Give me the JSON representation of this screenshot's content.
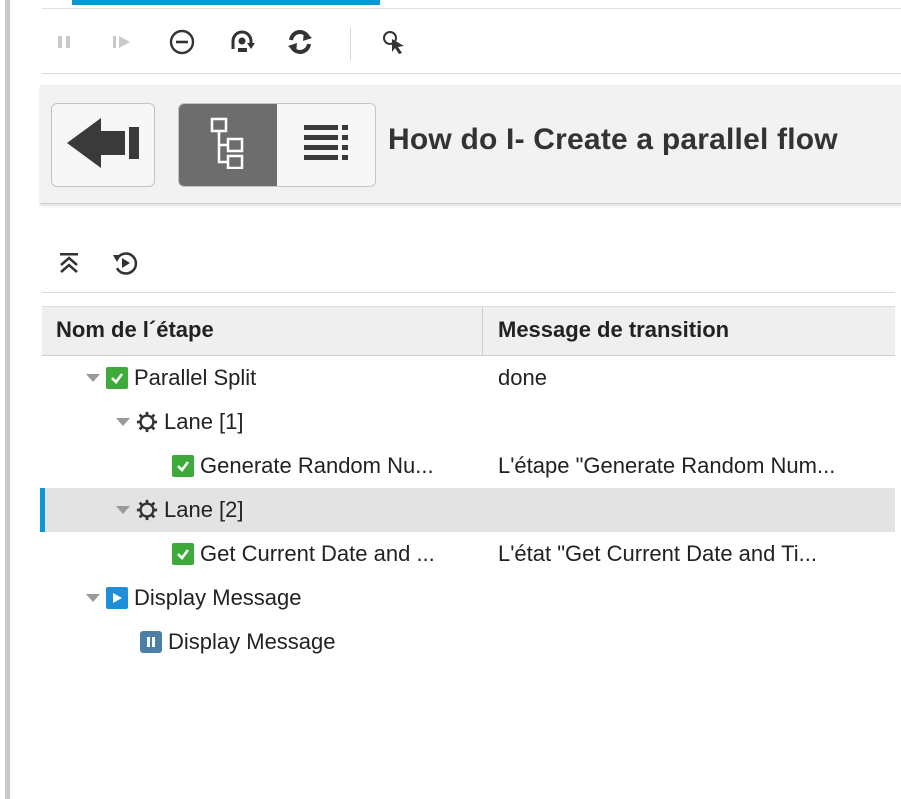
{
  "toolbar": {
    "buttons": [
      {
        "name": "pause-icon",
        "tip": "pause"
      },
      {
        "name": "resume-icon",
        "tip": "resume"
      },
      {
        "name": "cancel-icon",
        "tip": "cancel"
      },
      {
        "name": "reassign-icon",
        "tip": "reassign"
      },
      {
        "name": "refresh-icon",
        "tip": "refresh"
      },
      {
        "name": "cursor-select-icon",
        "tip": "select"
      }
    ]
  },
  "header": {
    "title": "How do I- Create a parallel flow",
    "back_icon": "back-arrow-icon",
    "tree_view_icon": "tree-view-icon",
    "list_view_icon": "list-view-icon"
  },
  "tree_tools": {
    "collapse_icon": "collapse-all-icon",
    "replay_icon": "replay-icon"
  },
  "grid": {
    "columns": [
      "Nom de l´étape",
      "Message de transition"
    ],
    "rows": [
      {
        "name": "Parallel Split",
        "message": "done",
        "status": "success",
        "indent": 0,
        "expandable": true
      },
      {
        "name": "Lane [1]",
        "message": "",
        "status": "lane",
        "indent": 1,
        "expandable": true
      },
      {
        "name": "Generate Random Nu...",
        "message": "L'étape \"Generate Random Num...",
        "status": "success",
        "indent": 2,
        "expandable": false
      },
      {
        "name": "Lane [2]",
        "message": "",
        "status": "lane",
        "indent": 1,
        "expandable": true,
        "selected": true
      },
      {
        "name": "Get Current Date and ...",
        "message": "L'état \"Get Current Date and Ti...",
        "status": "success",
        "indent": 2,
        "expandable": false
      },
      {
        "name": "Display Message",
        "message": "",
        "status": "running",
        "indent": 0,
        "expandable": true
      },
      {
        "name": "Display Message",
        "message": "",
        "status": "paused",
        "indent": 1,
        "expandable": false
      }
    ]
  },
  "colors": {
    "accent": "#0b96d6",
    "success": "#3eaa3c",
    "running": "#1e8fd6",
    "paused": "#4c7fa6",
    "selected_row": "#e3e3e3"
  }
}
